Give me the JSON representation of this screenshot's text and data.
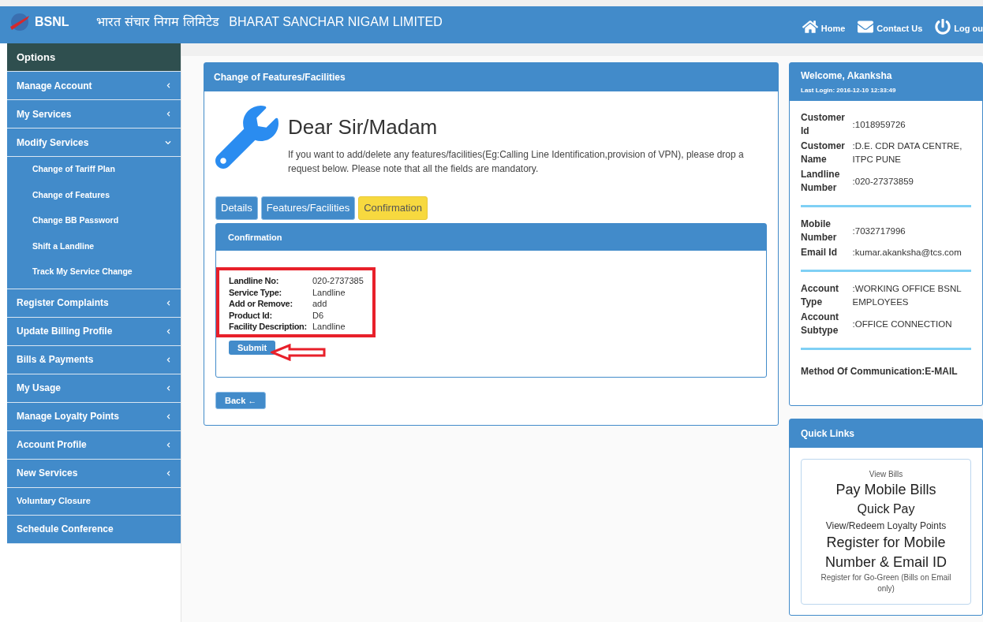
{
  "header": {
    "logo": "BSNL",
    "title_hindi": "भारत संचार निगम लिमिटेड",
    "title": "BHARAT SANCHAR NIGAM LIMITED",
    "nav": [
      {
        "kind": "home",
        "label": "Home"
      },
      {
        "kind": "mail",
        "label": "Contact Us"
      },
      {
        "kind": "power",
        "label": "Log ou"
      }
    ]
  },
  "sidebar": {
    "title": "Options",
    "items": [
      {
        "label": "Manage Account",
        "kind": "group",
        "expanded": false
      },
      {
        "label": "My Services",
        "kind": "group",
        "expanded": false
      },
      {
        "label": "Modify Services",
        "kind": "group",
        "expanded": true,
        "children": [
          {
            "label": "Change of Tariff Plan"
          },
          {
            "label": "Change of Features"
          },
          {
            "label": "Change BB Password"
          },
          {
            "label": "Shift a Landline"
          },
          {
            "label": "Track My Service Change"
          }
        ]
      },
      {
        "label": "Register Complaints",
        "kind": "group",
        "expanded": false
      },
      {
        "label": "Update Billing Profile",
        "kind": "group",
        "expanded": false
      },
      {
        "label": "Bills & Payments",
        "kind": "group",
        "expanded": false
      },
      {
        "label": "My Usage",
        "kind": "group",
        "expanded": false
      },
      {
        "label": "Manage Loyalty Points",
        "kind": "group",
        "expanded": false
      },
      {
        "label": "Account Profile",
        "kind": "group",
        "expanded": false
      },
      {
        "label": "New Services",
        "kind": "group",
        "expanded": false
      },
      {
        "label": "Voluntary Closure",
        "kind": "small_link"
      },
      {
        "label": "Schedule Conference",
        "kind": "link"
      }
    ]
  },
  "main": {
    "panel_title": "Change of Features/Facilities",
    "greeting": "Dear Sir/Madam",
    "intro": "If you want to add/delete any features/facilities(Eg:Calling Line Identification,provision of VPN), please drop a request below. Please note that all the fields are mandatory.",
    "tabs": [
      {
        "label": "Details",
        "selected": false
      },
      {
        "label": "Features/Facilities",
        "selected": false
      },
      {
        "label": "Confirmation",
        "selected": true
      }
    ],
    "confirmation": {
      "title": "Confirmation",
      "rows": [
        {
          "label": "Landline No:",
          "value": "020-2737385"
        },
        {
          "label": "Service Type:",
          "value": "Landline"
        },
        {
          "label": "Add or Remove:",
          "value": "add"
        },
        {
          "label": "Product Id:",
          "value": "D6"
        },
        {
          "label": "Facility Description:",
          "value": "Landline"
        }
      ],
      "submit": "Submit"
    },
    "back": "Back ←"
  },
  "profile": {
    "welcome": "Welcome, Akanksha",
    "last_login": "Last Login: 2016-12-10 12:33:49",
    "sections": [
      [
        {
          "label": "Customer Id",
          "value": ":1018959726"
        },
        {
          "label": "Customer Name",
          "value": ":D.E. CDR DATA CENTRE, ITPC PUNE"
        },
        {
          "label": "Landline Number",
          "value": ":020-27373859"
        }
      ],
      [
        {
          "label": "Mobile Number",
          "value": ":7032717996"
        },
        {
          "label": "Email Id",
          "value": ":kumar.akanksha@tcs.com"
        }
      ],
      [
        {
          "label": "Account Type",
          "value": ":WORKING OFFICE BSNL EMPLOYEES"
        },
        {
          "label": "Account Subtype",
          "value": ":OFFICE CONNECTION"
        }
      ]
    ],
    "method": "Method Of Communication:E-MAIL"
  },
  "quick_links": {
    "title": "Quick Links",
    "links": [
      {
        "label": "View Bills",
        "kind": "small"
      },
      {
        "label": "Pay Mobile Bills",
        "kind": "large"
      },
      {
        "label": "Quick Pay",
        "kind": "medium"
      },
      {
        "label": "View/Redeem Loyalty Points",
        "kind": "caption"
      },
      {
        "label": "Register for Mobile Number & Email ID",
        "kind": "large"
      },
      {
        "label": "Register for Go-Green (Bills on Email only)",
        "kind": "small"
      }
    ]
  }
}
